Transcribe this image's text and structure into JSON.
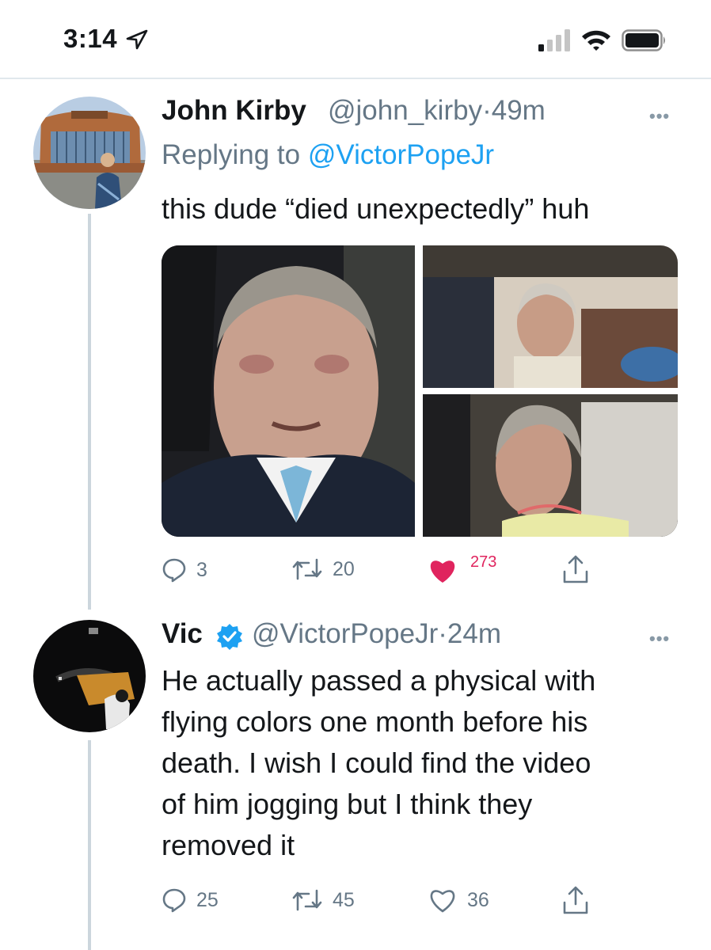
{
  "status_bar": {
    "time": "3:14",
    "icons": [
      "location-arrow-icon",
      "cellular-signal-icon",
      "wifi-icon",
      "battery-icon"
    ]
  },
  "tweets": [
    {
      "name": "John Kirby",
      "handle": "@john_kirby",
      "separator": "·",
      "time": "49m",
      "replying_prefix": "Replying to ",
      "replying_to": "@VictorPopeJr",
      "text": "this dude “died unexpectedly” huh",
      "media_count": 3,
      "actions": {
        "replies": "3",
        "retweets": "20",
        "likes_partial": "273",
        "liked": true
      }
    },
    {
      "name": "Vic",
      "verified": true,
      "handle": "@VictorPopeJr",
      "separator": "·",
      "time": "24m",
      "text_lines": [
        "He actually passed a physical with",
        "flying colors one month before his",
        "death. I wish I could find the video",
        "of him jogging but I think they",
        "removed it"
      ],
      "actions": {
        "replies": "25",
        "retweets": "45",
        "likes": "36",
        "liked": false
      }
    }
  ],
  "colors": {
    "link_blue": "#1da1f2",
    "gray_text": "#657786",
    "like_red": "#e0245e",
    "thread_line": "#ccd6dd"
  }
}
